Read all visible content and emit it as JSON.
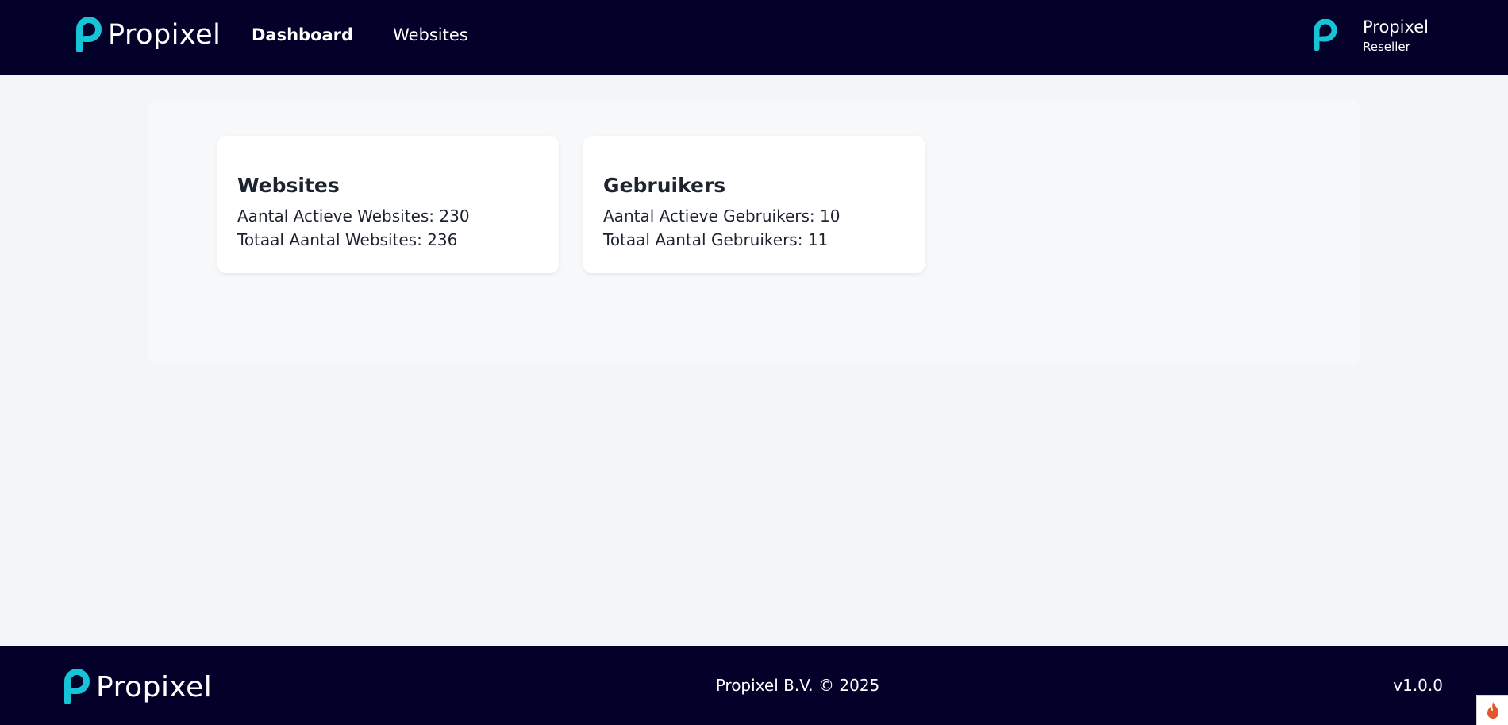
{
  "brand": {
    "name": "Propixel",
    "accent": "#17c3d6",
    "nav_bg": "#03012a"
  },
  "nav": {
    "items": [
      {
        "label": "Dashboard",
        "active": true
      },
      {
        "label": "Websites",
        "active": false
      }
    ]
  },
  "user": {
    "name": "Propixel",
    "role": "Reseller",
    "avatar_icon": "propixel-p-icon"
  },
  "cards": [
    {
      "title": "Websites",
      "lines": [
        "Aantal Actieve Websites: 230",
        "Totaal Aantal Websites: 236"
      ]
    },
    {
      "title": "Gebruikers",
      "lines": [
        "Aantal Actieve Gebruikers: 10",
        "Totaal Aantal Gebruikers: 11"
      ]
    }
  ],
  "footer": {
    "copyright": "Propixel B.V. © 2025",
    "version": "v1.0.0"
  },
  "corner_widget": {
    "icon": "flame-icon",
    "color": "#e4572e"
  }
}
